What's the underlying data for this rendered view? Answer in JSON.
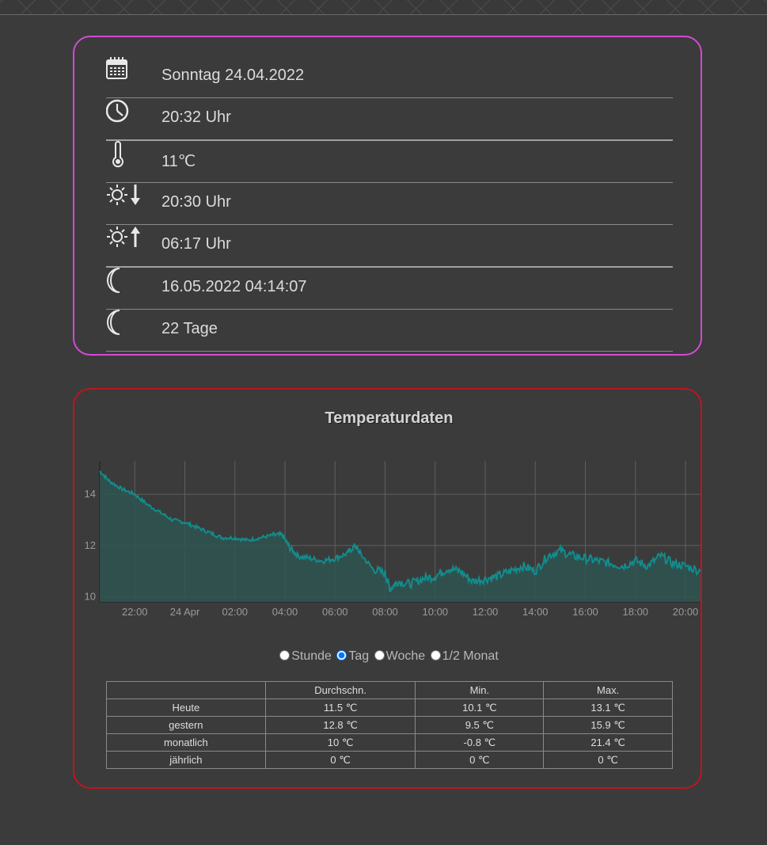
{
  "info": {
    "rows": [
      {
        "icon": "calendar-icon",
        "text": "Sonntag 24.04.2022"
      },
      {
        "icon": "clock-icon",
        "text": "20:32 Uhr"
      },
      {
        "icon": "thermometer-icon",
        "text": "11℃"
      },
      {
        "icon": "sunset-icon",
        "text": "20:30 Uhr"
      },
      {
        "icon": "sunrise-icon",
        "text": "06:17 Uhr"
      },
      {
        "icon": "moon-icon",
        "text": "16.05.2022 04:14:07"
      },
      {
        "icon": "moon-icon",
        "text": "22 Tage"
      }
    ]
  },
  "temperature": {
    "title": "Temperaturdaten",
    "range_options": [
      {
        "label": "Stunde",
        "checked": false
      },
      {
        "label": "Tag",
        "checked": true
      },
      {
        "label": "Woche",
        "checked": false
      },
      {
        "label": "1/2 Monat",
        "checked": false
      }
    ],
    "table": {
      "headers": [
        "",
        "Durchschn.",
        "Min.",
        "Max."
      ],
      "rows": [
        [
          "Heute",
          "11.5 ℃",
          "10.1 ℃",
          "13.1 ℃"
        ],
        [
          "gestern",
          "12.8 ℃",
          "9.5 ℃",
          "15.9 ℃"
        ],
        [
          "monatlich",
          "10 ℃",
          "-0.8 ℃",
          "21.4 ℃"
        ],
        [
          "jährlich",
          "0 ℃",
          "0 ℃",
          "0 ℃"
        ]
      ]
    }
  },
  "chart_data": {
    "type": "area",
    "title": "Temperaturdaten",
    "xlabel": "",
    "ylabel": "",
    "x_tick_labels": [
      "22:00",
      "24 Apr",
      "02:00",
      "04:00",
      "06:00",
      "08:00",
      "10:00",
      "12:00",
      "14:00",
      "16:00",
      "18:00",
      "20:00"
    ],
    "y_ticks": [
      10,
      12,
      14
    ],
    "ylim": [
      9.8,
      15.3
    ],
    "x_range_hours": [
      -3.4,
      20.6
    ],
    "grid": true,
    "colors": {
      "line": "#128c8c",
      "fill": "#2f5552"
    },
    "series": [
      {
        "x": [
          -3.4,
          -3.0,
          -2.5,
          -2.0,
          -1.5,
          -1.0,
          -0.5,
          0.0,
          0.5,
          1.0,
          1.5,
          2.0,
          2.5,
          3.0,
          3.5,
          3.9,
          4.2,
          4.5,
          5.0,
          5.5,
          6.0,
          6.5,
          6.8,
          7.0,
          7.5,
          8.0,
          8.2,
          8.5,
          9.0,
          9.5,
          10.0,
          10.5,
          11.0,
          11.5,
          12.0,
          12.5,
          13.0,
          13.5,
          14.0,
          14.5,
          15.0,
          15.5,
          16.0,
          16.5,
          17.0,
          17.5,
          18.0,
          18.5,
          19.0,
          19.5,
          20.0,
          20.6
        ],
        "y": [
          14.9,
          14.5,
          14.2,
          14.0,
          13.6,
          13.3,
          13.0,
          12.9,
          12.7,
          12.5,
          12.3,
          12.3,
          12.2,
          12.3,
          12.4,
          12.4,
          11.9,
          11.6,
          11.5,
          11.4,
          11.5,
          11.7,
          12.0,
          11.7,
          11.1,
          10.9,
          10.3,
          10.6,
          10.5,
          10.7,
          10.8,
          11.1,
          11.0,
          10.6,
          10.7,
          10.8,
          11.0,
          11.2,
          11.0,
          11.6,
          11.8,
          11.6,
          11.5,
          11.4,
          11.3,
          11.2,
          11.4,
          11.2,
          11.6,
          11.3,
          11.2,
          11.0
        ]
      }
    ]
  }
}
